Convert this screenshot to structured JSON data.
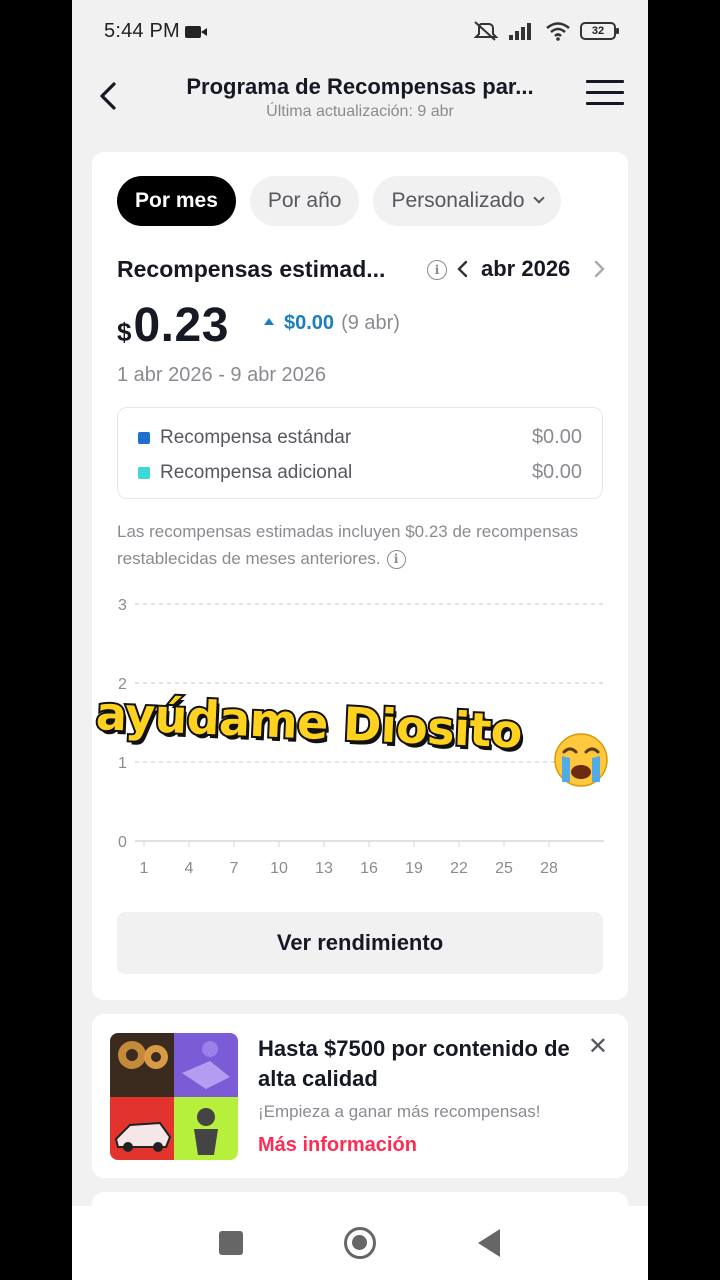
{
  "status_bar": {
    "time": "5:44 PM",
    "battery": "32"
  },
  "header": {
    "title": "Programa de Recompensas par...",
    "subtitle": "Última actualización: 9 abr"
  },
  "filters": {
    "tabs": [
      {
        "label": "Por mes",
        "active": true
      },
      {
        "label": "Por año",
        "active": false
      },
      {
        "label": "Personalizado",
        "active": false
      }
    ]
  },
  "rewards": {
    "title": "Recompensas estimad...",
    "month": "abr 2026",
    "currency_symbol": "$",
    "amount": "0.23",
    "delta_value": "$0.00",
    "delta_date": "(9 abr)",
    "date_range": "1 abr 2026 - 9 abr 2026",
    "breakdown": [
      {
        "label": "Recompensa estándar",
        "value": "$0.00",
        "color": "#1f6fd1"
      },
      {
        "label": "Recompensa adicional",
        "value": "$0.00",
        "color": "#3dd9d6"
      }
    ],
    "note": "Las recompensas estimadas incluyen $0.23 de recompensas restablecidas de meses anteriores."
  },
  "chart_data": {
    "type": "line",
    "x_ticks": [
      "1",
      "4",
      "7",
      "10",
      "13",
      "16",
      "19",
      "22",
      "25",
      "28"
    ],
    "y_ticks": [
      "0",
      "1",
      "2",
      "3"
    ],
    "ylim": [
      0,
      3
    ],
    "series": [],
    "grid": true
  },
  "actions": {
    "performance_button": "Ver rendimiento"
  },
  "promo": {
    "title": "Hasta $7500 por contenido de alta calidad",
    "subtitle": "¡Empieza a ganar más recompensas!",
    "link": "Más información"
  },
  "overlay": {
    "caption": "ayúdame Diosito"
  }
}
